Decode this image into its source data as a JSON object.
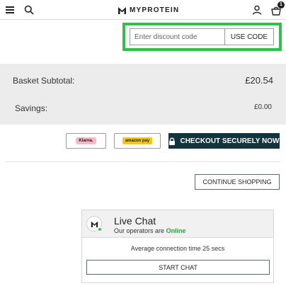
{
  "header": {
    "brand": "MYPROTEIN",
    "basket_count": "1"
  },
  "discount": {
    "placeholder": "Enter discount code",
    "value": "",
    "button_label": "USE CODE",
    "highlight_color": "#2fc04a"
  },
  "summary": {
    "subtotal_label": "Basket Subtotal:",
    "subtotal_value": "£20.54",
    "savings_label": "Savings:",
    "savings_value": "£0.00"
  },
  "payment": {
    "klarna_label": "Klarna.",
    "amazon_label": "amazon pay",
    "checkout_label": "CHECKOUT SECURELY NOW",
    "checkout_color": "#13343d"
  },
  "continue_label": "CONTINUE SHOPPING",
  "live_chat": {
    "title": "Live Chat",
    "subtitle_prefix": "Our operators are",
    "status": "Online",
    "connection_text": "Average connection time 25 secs",
    "start_label": "START CHAT"
  }
}
